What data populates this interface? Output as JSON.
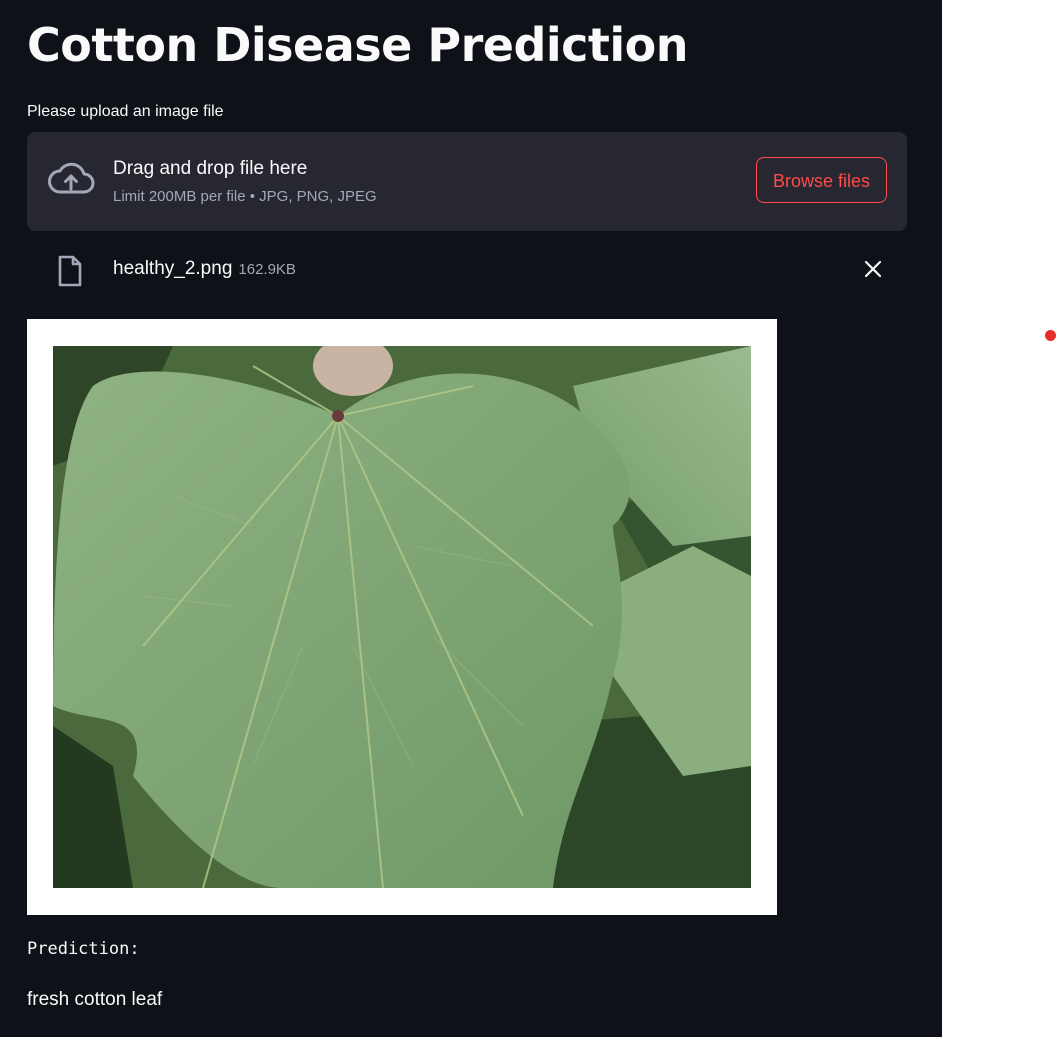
{
  "app": {
    "title": "Cotton Disease Prediction"
  },
  "uploader": {
    "label": "Please upload an image file",
    "dropzone_text": "Drag and drop file here",
    "limit_text": "Limit 200MB per file • JPG, PNG, JPEG",
    "browse_label": "Browse files",
    "cloud_icon": "cloud-upload-icon"
  },
  "uploaded_file": {
    "name": "healthy_2.png",
    "size": "162.9KB",
    "file_icon": "file-icon",
    "remove_icon": "close-icon"
  },
  "prediction": {
    "label": "Prediction:",
    "value": "fresh cotton leaf"
  },
  "colors": {
    "background": "#0e1117",
    "panel": "#262730",
    "accent": "#ff4b4b",
    "text": "#fafafa",
    "muted": "#a3a8b8"
  }
}
